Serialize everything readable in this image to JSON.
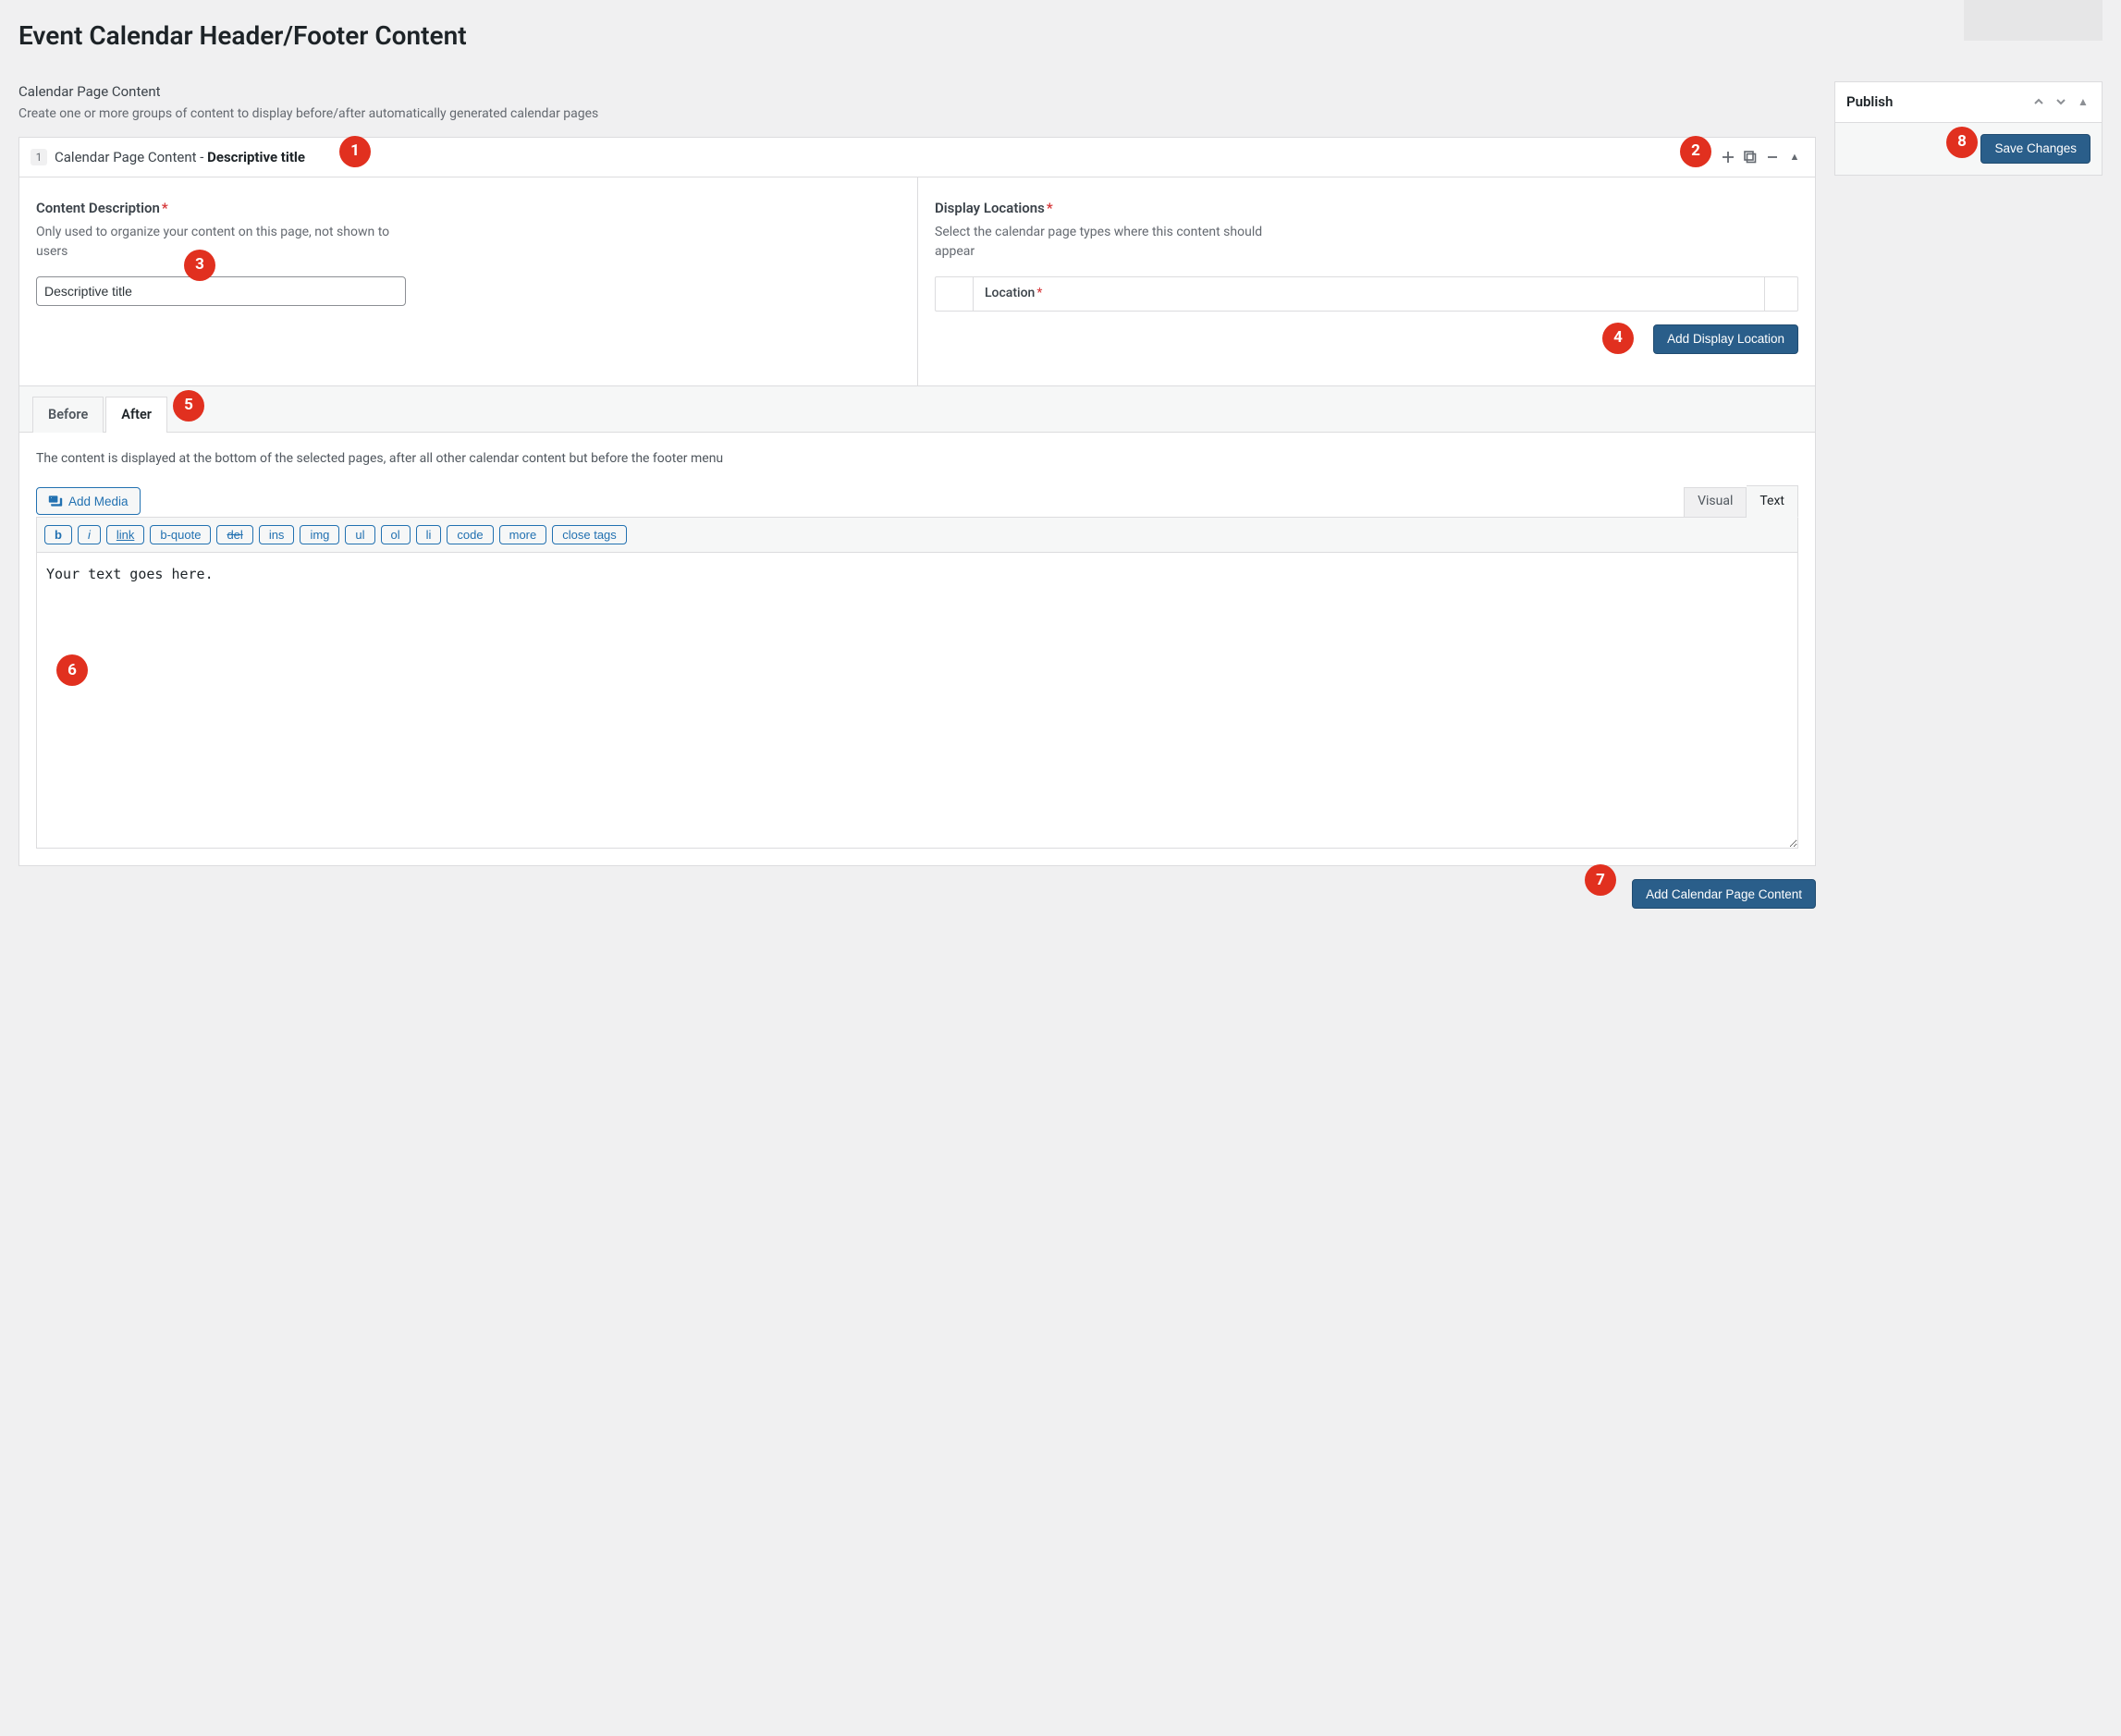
{
  "page": {
    "title": "Event Calendar Header/Footer Content"
  },
  "repeater": {
    "section_label": "Calendar Page Content",
    "section_description": "Create one or more groups of content to display before/after automatically generated calendar pages",
    "row_number": "1",
    "row_title_prefix": "Calendar Page Content - ",
    "row_title_value": "Descriptive title",
    "add_row_button": "Add Calendar Page Content"
  },
  "content_description": {
    "label": "Content Description",
    "help": "Only used to organize your content on this page, not shown to users",
    "value": "Descriptive title"
  },
  "display_locations": {
    "label": "Display Locations",
    "help": "Select the calendar page types where this content should appear",
    "col_label": "Location",
    "add_button": "Add Display Location"
  },
  "tabs": {
    "before": "Before",
    "after": "After",
    "after_description": "The content is displayed at the bottom of the selected pages, after all other calendar content but before the footer menu"
  },
  "editor": {
    "add_media": "Add Media",
    "mode_visual": "Visual",
    "mode_text": "Text",
    "quicktags": {
      "b": "b",
      "i": "i",
      "link": "link",
      "bquote": "b-quote",
      "del": "del",
      "ins": "ins",
      "img": "img",
      "ul": "ul",
      "ol": "ol",
      "li": "li",
      "code": "code",
      "more": "more",
      "close": "close tags"
    },
    "content": "Your text goes here."
  },
  "publish": {
    "title": "Publish",
    "save": "Save Changes"
  },
  "annotations": [
    "1",
    "2",
    "3",
    "4",
    "5",
    "6",
    "7",
    "8"
  ]
}
